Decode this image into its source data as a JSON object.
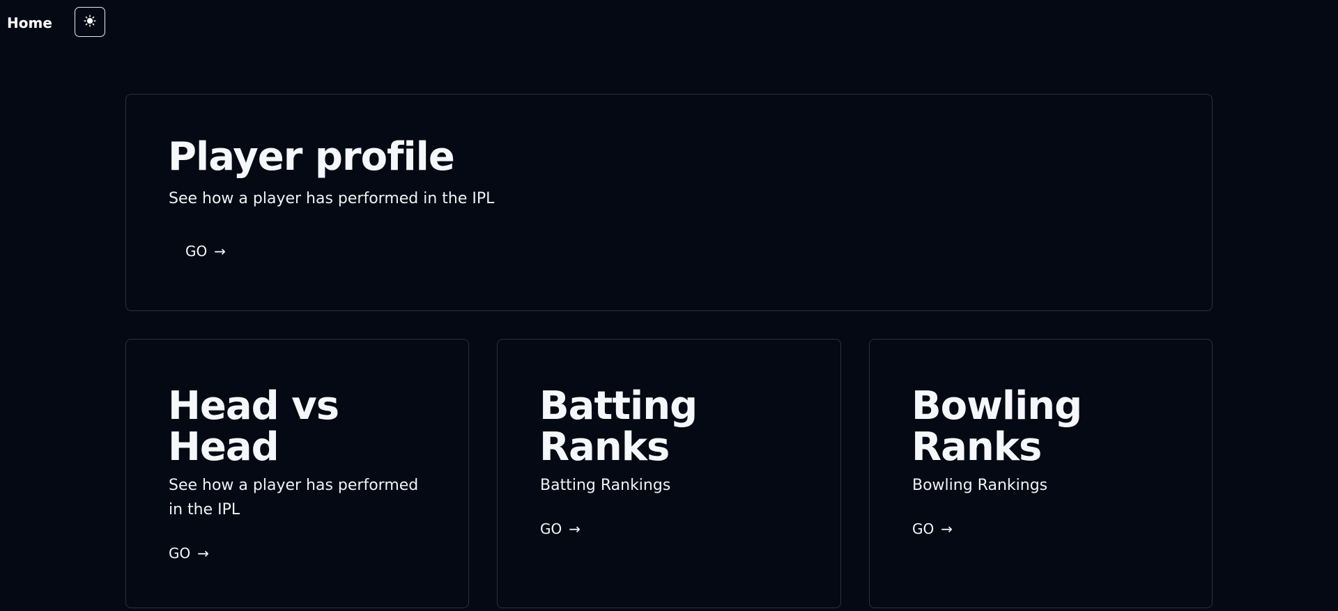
{
  "nav": {
    "home_label": "Home",
    "theme_toggle_icon": "sun-icon"
  },
  "featured": {
    "title": "Player profile",
    "description": "See how a player has performed in the IPL",
    "go_label": "GO",
    "arrow": "→"
  },
  "cards": [
    {
      "title": "Head vs Head",
      "description": "See how a player has performed in the IPL",
      "go_label": "GO",
      "arrow": "→"
    },
    {
      "title": "Batting Ranks",
      "description": "Batting Rankings",
      "go_label": "GO",
      "arrow": "→"
    },
    {
      "title": "Bowling Ranks",
      "description": "Bowling Rankings",
      "go_label": "GO",
      "arrow": "→"
    }
  ],
  "colors": {
    "background": "#050914",
    "card_border": "#2a3140",
    "text": "#f5f7fa"
  }
}
